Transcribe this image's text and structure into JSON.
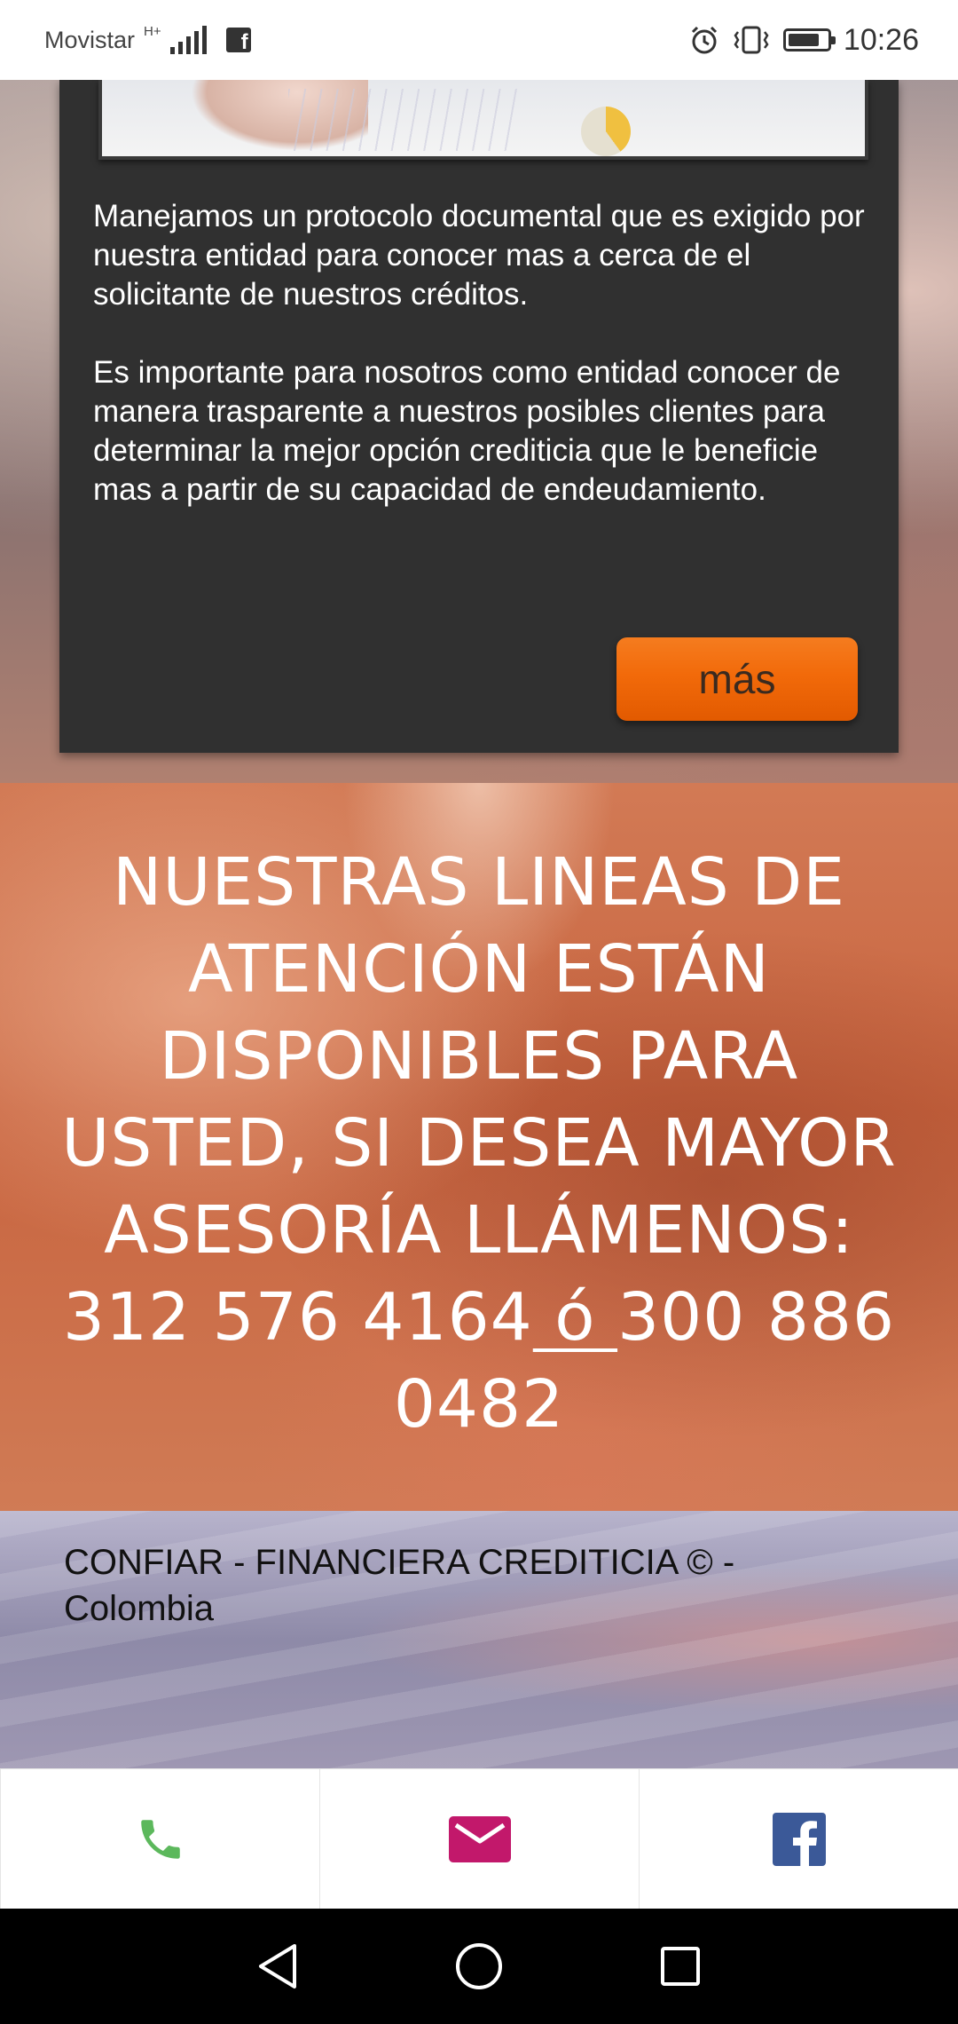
{
  "status_bar": {
    "carrier": "Movistar",
    "network_type": "H+",
    "time": "10:26",
    "icons": [
      "signal-icon",
      "facebook-notification-icon",
      "alarm-icon",
      "vibrate-icon",
      "battery-icon"
    ]
  },
  "card": {
    "paragraph_1": "Manejamos un protocolo documental que es exigido por nuestra entidad para conocer mas a cerca de el solicitante de nuestros créditos.",
    "paragraph_2": "Es importante para nosotros como entidad conocer de manera trasparente a nuestros posibles clientes para determinar la mejor opción crediticia que le beneficie mas a partir de su capacidad de endeudamiento.",
    "button_label": "más"
  },
  "contact": {
    "text_before": "NUESTRAS LINEAS DE ATENCIÓN ESTÁN DISPONIBLES PARA USTED, SI DESEA MAYOR ASESORÍA LLÁMENOS: 312 576 4164",
    "or_link": " ó ",
    "text_after": "300 886 0482"
  },
  "footer": {
    "text": "CONFIAR - FINANCIERA CREDITICIA  © - Colombia"
  },
  "action_bar": {
    "phone_color": "#5cb85c",
    "email_color": "#c2186b",
    "facebook_color": "#3b5998"
  },
  "colors": {
    "card_bg": "#303030",
    "button_orange": "#f26a0a",
    "band_orange": "#c8643f"
  }
}
